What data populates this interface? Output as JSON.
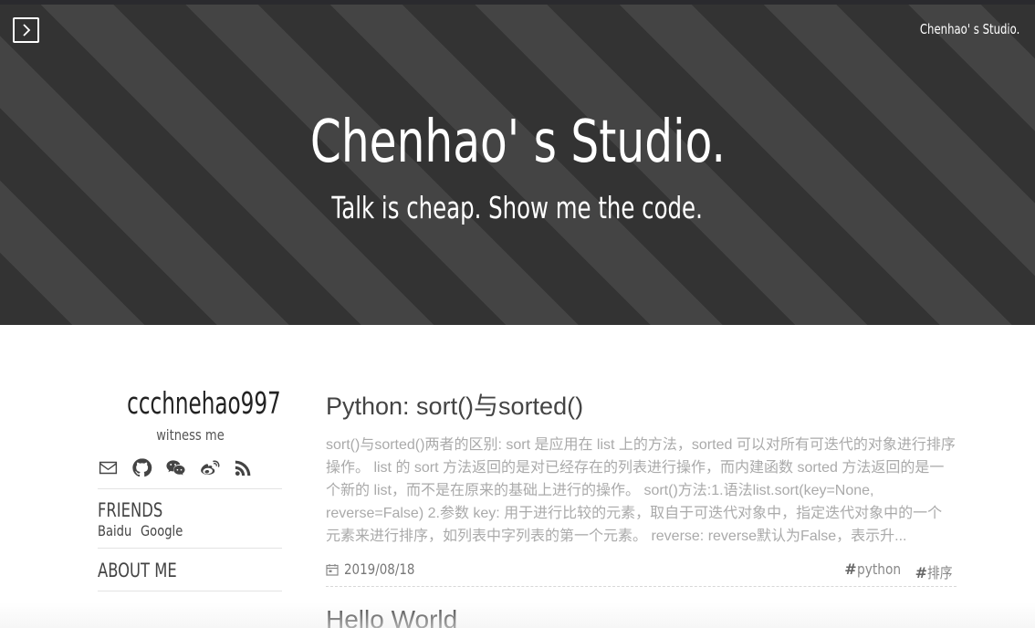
{
  "header": {
    "menu_icon": "chevron-right-icon",
    "brand": "Chenhao' s Studio.",
    "title": "Chenhao' s Studio.",
    "subtitle": "Talk is cheap. Show me the code.",
    "colors": {
      "band_dark": "#333333",
      "band_light": "#444444",
      "text": "#ffffff"
    }
  },
  "sidebar": {
    "author": "ccchnehao997",
    "motto": "witness me",
    "social_icons": [
      "mail-icon",
      "github-icon",
      "wechat-icon",
      "weibo-icon",
      "rss-icon"
    ],
    "friends_title": "FRIENDS",
    "friends": [
      "Baidu",
      "Google"
    ],
    "about_title": "ABOUT ME"
  },
  "posts": [
    {
      "title": "Python: sort()与sorted()",
      "excerpt": "sort()与sorted()两者的区别: sort 是应用在 list 上的方法，sorted 可以对所有可迭代的对象进行排序操作。 list 的 sort 方法返回的是对已经存在的列表进行操作，而内建函数 sorted 方法返回的是一个新的 list，而不是在原来的基础上进行的操作。 sort()方法:1.语法list.sort(key=None, reverse=False) 2.参数 key: 用于进行比较的元素，取自于可迭代对象中，指定迭代对象中的一个元素来进行排序，如列表中字列表的第一个元素。 reverse: reverse默认为False，表示升...",
      "date": "2019/08/18",
      "tags": [
        "python",
        "排序"
      ]
    },
    {
      "title": "Hello World"
    }
  ]
}
